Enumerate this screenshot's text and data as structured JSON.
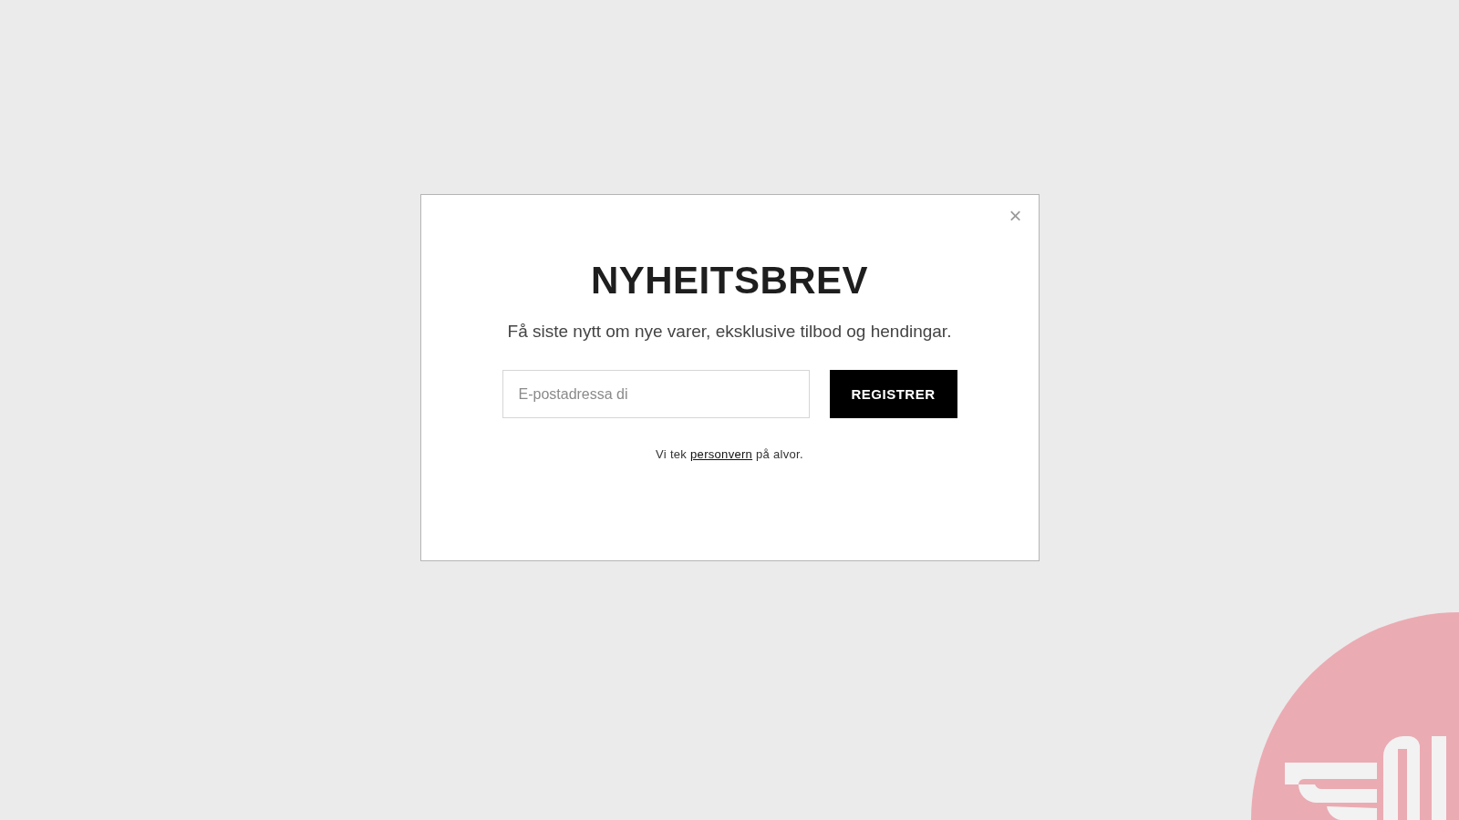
{
  "dialog": {
    "close": "×",
    "title": "NYHEITSBREV",
    "subtitle": "Få siste nytt om nye varer, eksklusive tilbod og hendingar.",
    "email_field": {
      "placeholder": "E-postadressa di"
    },
    "submit_button": "REGISTRER",
    "privacy_note": {
      "before": "Vi tek",
      "link": "personvern",
      "after": "på alvor."
    }
  }
}
